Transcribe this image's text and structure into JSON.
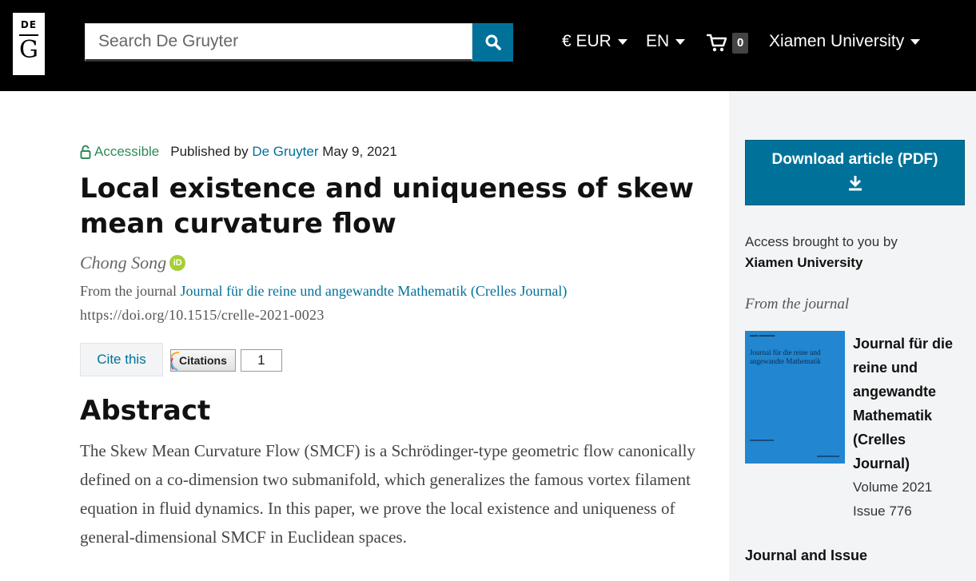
{
  "header": {
    "logo_top": "DE",
    "logo_bottom": "G",
    "search_placeholder": "Search De Gruyter",
    "currency": "€ EUR",
    "language": "EN",
    "cart_count": "0",
    "institution": "Xiamen University"
  },
  "article": {
    "access_label": "Accessible",
    "published_by_prefix": "Published by",
    "publisher": "De Gruyter",
    "date": "May 9, 2021",
    "title": "Local existence and uniqueness of skew mean curvature flow",
    "author": "Chong Song",
    "orcid_label": "iD",
    "from_journal_prefix": "From the journal",
    "journal": "Journal für die reine und angewandte Mathematik (Crelles Journal)",
    "doi": "https://doi.org/10.1515/crelle-2021-0023",
    "cite_label": "Cite this",
    "citations_label": "Citations",
    "citations_count": "1",
    "abstract_heading": "Abstract",
    "abstract_text": "The Skew Mean Curvature Flow (SMCF) is a Schrödinger-type geometric flow canonically defined on a co-dimension two submanifold, which generalizes the famous vortex filament equation in fluid dynamics. In this paper, we prove the local existence and uniqueness of general-dimensional SMCF in Euclidean spaces."
  },
  "sidebar": {
    "download_label": "Download article (PDF)",
    "access_prefix": "Access brought to you by",
    "access_institution": "Xiamen University",
    "from_journal": "From the journal",
    "cover_title": "Journal für die reine und angewandte Mathematik",
    "journal_name": "Journal für die reine und angewandte Mathematik (Crelles Journal)",
    "volume": "Volume 2021",
    "issue": "Issue 776",
    "journal_and_issue": "Journal and Issue"
  },
  "colors": {
    "accent": "#00729a",
    "accessible_green": "#2e8b57",
    "header_bg": "#000000",
    "sidebar_bg": "#f3f4f5",
    "cover_blue": "#2286d0"
  },
  "icons": [
    "lock-open-icon",
    "search-icon",
    "caret-down-icon",
    "cart-icon",
    "orcid-icon",
    "download-icon",
    "citations-badge-icon"
  ]
}
